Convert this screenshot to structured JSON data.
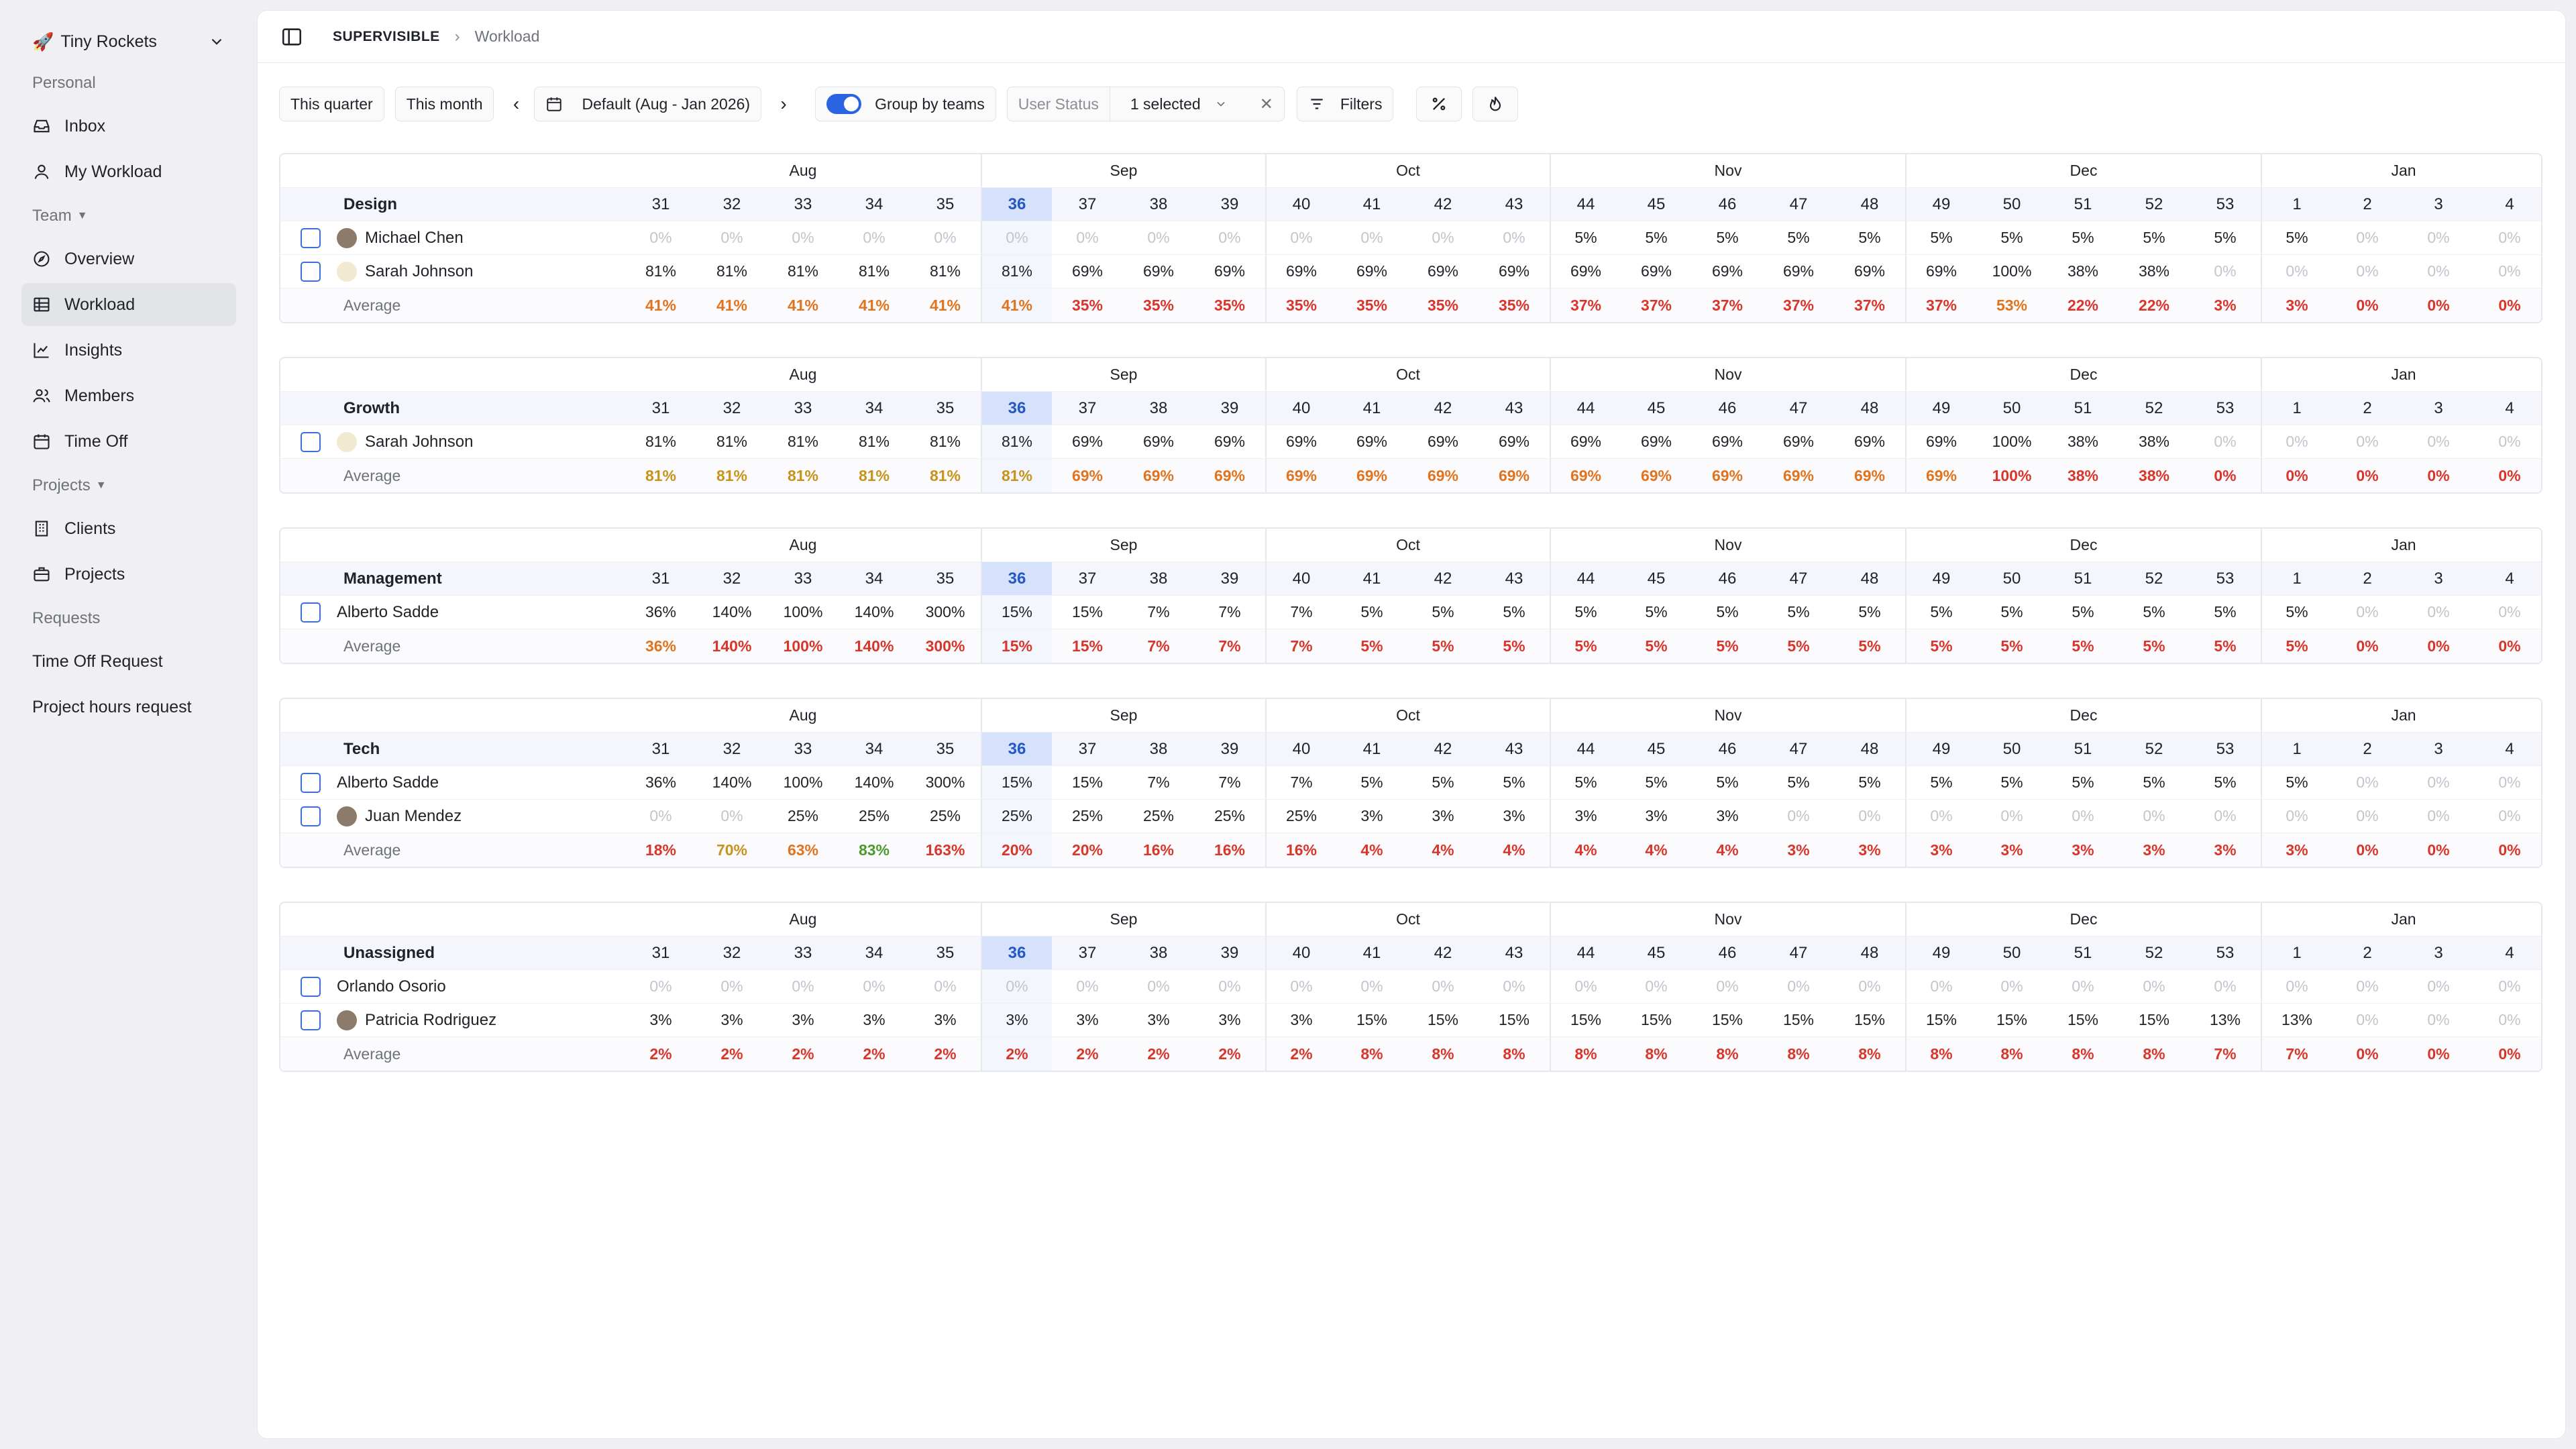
{
  "sidebar": {
    "workspace": "Tiny Rockets",
    "personal_label": "Personal",
    "team_label": "Team",
    "projects_label": "Projects",
    "requests_label": "Requests",
    "items": {
      "inbox": "Inbox",
      "my_workload": "My Workload",
      "overview": "Overview",
      "workload": "Workload",
      "insights": "Insights",
      "members": "Members",
      "time_off": "Time Off",
      "clients": "Clients",
      "projects": "Projects",
      "time_off_request": "Time Off Request",
      "project_hours_request": "Project hours request"
    }
  },
  "breadcrumb": {
    "root": "SUPERVISIBLE",
    "page": "Workload"
  },
  "toolbar": {
    "this_quarter": "This quarter",
    "this_month": "This month",
    "date_range": "Default (Aug - Jan 2026)",
    "group_by_teams": "Group by teams",
    "user_status_label": "User Status",
    "user_status_value": "1 selected",
    "filters": "Filters"
  },
  "months": [
    {
      "label": "Aug",
      "weeks": 5
    },
    {
      "label": "Sep",
      "weeks": 4
    },
    {
      "label": "Oct",
      "weeks": 4
    },
    {
      "label": "Nov",
      "weeks": 5
    },
    {
      "label": "Dec",
      "weeks": 5
    },
    {
      "label": "Jan",
      "weeks": 4
    }
  ],
  "weeks": [
    "31",
    "32",
    "33",
    "34",
    "35",
    "36",
    "37",
    "38",
    "39",
    "40",
    "41",
    "42",
    "43",
    "44",
    "45",
    "46",
    "47",
    "48",
    "49",
    "50",
    "51",
    "52",
    "53",
    "1",
    "2",
    "3",
    "4"
  ],
  "current_week": "36",
  "colors": {
    "red": "#d9352b",
    "orange": "#e2731d",
    "amber": "#c8921b",
    "green": "#4d9a2b",
    "accent": "#2b64e3"
  },
  "average_label": "Average",
  "teams": [
    {
      "name": "Design",
      "members": [
        {
          "name": "Michael Chen",
          "avatar": "photo",
          "values": [
            "0%",
            "0%",
            "0%",
            "0%",
            "0%",
            "0%",
            "0%",
            "0%",
            "0%",
            "0%",
            "0%",
            "0%",
            "0%",
            "5%",
            "5%",
            "5%",
            "5%",
            "5%",
            "5%",
            "5%",
            "5%",
            "5%",
            "5%",
            "5%",
            "0%",
            "0%",
            "0%"
          ]
        },
        {
          "name": "Sarah Johnson",
          "avatar": "light",
          "values": [
            "81%",
            "81%",
            "81%",
            "81%",
            "81%",
            "81%",
            "69%",
            "69%",
            "69%",
            "69%",
            "69%",
            "69%",
            "69%",
            "69%",
            "69%",
            "69%",
            "69%",
            "69%",
            "69%",
            "100%",
            "38%",
            "38%",
            "0%",
            "0%",
            "0%",
            "0%",
            "0%"
          ]
        }
      ],
      "average": [
        "41%",
        "41%",
        "41%",
        "41%",
        "41%",
        "41%",
        "35%",
        "35%",
        "35%",
        "35%",
        "35%",
        "35%",
        "35%",
        "37%",
        "37%",
        "37%",
        "37%",
        "37%",
        "37%",
        "53%",
        "22%",
        "22%",
        "3%",
        "3%",
        "0%",
        "0%",
        "0%"
      ],
      "avg_colors": [
        "orange",
        "orange",
        "orange",
        "orange",
        "orange",
        "orange",
        "red",
        "red",
        "red",
        "red",
        "red",
        "red",
        "red",
        "red",
        "red",
        "red",
        "red",
        "red",
        "red",
        "orange",
        "red",
        "red",
        "red",
        "red",
        "red",
        "red",
        "red"
      ]
    },
    {
      "name": "Growth",
      "members": [
        {
          "name": "Sarah Johnson",
          "avatar": "light",
          "values": [
            "81%",
            "81%",
            "81%",
            "81%",
            "81%",
            "81%",
            "69%",
            "69%",
            "69%",
            "69%",
            "69%",
            "69%",
            "69%",
            "69%",
            "69%",
            "69%",
            "69%",
            "69%",
            "69%",
            "100%",
            "38%",
            "38%",
            "0%",
            "0%",
            "0%",
            "0%",
            "0%"
          ]
        }
      ],
      "average": [
        "81%",
        "81%",
        "81%",
        "81%",
        "81%",
        "81%",
        "69%",
        "69%",
        "69%",
        "69%",
        "69%",
        "69%",
        "69%",
        "69%",
        "69%",
        "69%",
        "69%",
        "69%",
        "69%",
        "100%",
        "38%",
        "38%",
        "0%",
        "0%",
        "0%",
        "0%",
        "0%"
      ],
      "avg_colors": [
        "amber",
        "amber",
        "amber",
        "amber",
        "amber",
        "amber",
        "orange",
        "orange",
        "orange",
        "orange",
        "orange",
        "orange",
        "orange",
        "orange",
        "orange",
        "orange",
        "orange",
        "orange",
        "orange",
        "red",
        "red",
        "red",
        "red",
        "red",
        "red",
        "red",
        "red"
      ]
    },
    {
      "name": "Management",
      "members": [
        {
          "name": "Alberto Sadde",
          "avatar": "none",
          "values": [
            "36%",
            "140%",
            "100%",
            "140%",
            "300%",
            "15%",
            "15%",
            "7%",
            "7%",
            "7%",
            "5%",
            "5%",
            "5%",
            "5%",
            "5%",
            "5%",
            "5%",
            "5%",
            "5%",
            "5%",
            "5%",
            "5%",
            "5%",
            "5%",
            "0%",
            "0%",
            "0%"
          ]
        }
      ],
      "average": [
        "36%",
        "140%",
        "100%",
        "140%",
        "300%",
        "15%",
        "15%",
        "7%",
        "7%",
        "7%",
        "5%",
        "5%",
        "5%",
        "5%",
        "5%",
        "5%",
        "5%",
        "5%",
        "5%",
        "5%",
        "5%",
        "5%",
        "5%",
        "5%",
        "0%",
        "0%",
        "0%"
      ],
      "avg_colors": [
        "orange",
        "red",
        "red",
        "red",
        "red",
        "red",
        "red",
        "red",
        "red",
        "red",
        "red",
        "red",
        "red",
        "red",
        "red",
        "red",
        "red",
        "red",
        "red",
        "red",
        "red",
        "red",
        "red",
        "red",
        "red",
        "red",
        "red"
      ]
    },
    {
      "name": "Tech",
      "members": [
        {
          "name": "Alberto Sadde",
          "avatar": "none",
          "values": [
            "36%",
            "140%",
            "100%",
            "140%",
            "300%",
            "15%",
            "15%",
            "7%",
            "7%",
            "7%",
            "5%",
            "5%",
            "5%",
            "5%",
            "5%",
            "5%",
            "5%",
            "5%",
            "5%",
            "5%",
            "5%",
            "5%",
            "5%",
            "5%",
            "0%",
            "0%",
            "0%"
          ]
        },
        {
          "name": "Juan Mendez",
          "avatar": "photo",
          "values": [
            "0%",
            "0%",
            "25%",
            "25%",
            "25%",
            "25%",
            "25%",
            "25%",
            "25%",
            "25%",
            "3%",
            "3%",
            "3%",
            "3%",
            "3%",
            "3%",
            "0%",
            "0%",
            "0%",
            "0%",
            "0%",
            "0%",
            "0%",
            "0%",
            "0%",
            "0%",
            "0%"
          ]
        }
      ],
      "average": [
        "18%",
        "70%",
        "63%",
        "83%",
        "163%",
        "20%",
        "20%",
        "16%",
        "16%",
        "16%",
        "4%",
        "4%",
        "4%",
        "4%",
        "4%",
        "4%",
        "3%",
        "3%",
        "3%",
        "3%",
        "3%",
        "3%",
        "3%",
        "3%",
        "0%",
        "0%",
        "0%"
      ],
      "avg_colors": [
        "red",
        "amber",
        "orange",
        "green",
        "red",
        "red",
        "red",
        "red",
        "red",
        "red",
        "red",
        "red",
        "red",
        "red",
        "red",
        "red",
        "red",
        "red",
        "red",
        "red",
        "red",
        "red",
        "red",
        "red",
        "red",
        "red",
        "red"
      ]
    },
    {
      "name": "Unassigned",
      "members": [
        {
          "name": "Orlando Osorio",
          "avatar": "none",
          "values": [
            "0%",
            "0%",
            "0%",
            "0%",
            "0%",
            "0%",
            "0%",
            "0%",
            "0%",
            "0%",
            "0%",
            "0%",
            "0%",
            "0%",
            "0%",
            "0%",
            "0%",
            "0%",
            "0%",
            "0%",
            "0%",
            "0%",
            "0%",
            "0%",
            "0%",
            "0%",
            "0%"
          ]
        },
        {
          "name": "Patricia Rodriguez",
          "avatar": "photo",
          "values": [
            "3%",
            "3%",
            "3%",
            "3%",
            "3%",
            "3%",
            "3%",
            "3%",
            "3%",
            "3%",
            "15%",
            "15%",
            "15%",
            "15%",
            "15%",
            "15%",
            "15%",
            "15%",
            "15%",
            "15%",
            "15%",
            "15%",
            "13%",
            "13%",
            "0%",
            "0%",
            "0%"
          ]
        }
      ],
      "average": [
        "2%",
        "2%",
        "2%",
        "2%",
        "2%",
        "2%",
        "2%",
        "2%",
        "2%",
        "2%",
        "8%",
        "8%",
        "8%",
        "8%",
        "8%",
        "8%",
        "8%",
        "8%",
        "8%",
        "8%",
        "8%",
        "8%",
        "7%",
        "7%",
        "0%",
        "0%",
        "0%"
      ],
      "avg_colors": [
        "red",
        "red",
        "red",
        "red",
        "red",
        "red",
        "red",
        "red",
        "red",
        "red",
        "red",
        "red",
        "red",
        "red",
        "red",
        "red",
        "red",
        "red",
        "red",
        "red",
        "red",
        "red",
        "red",
        "red",
        "red",
        "red",
        "red"
      ]
    }
  ]
}
